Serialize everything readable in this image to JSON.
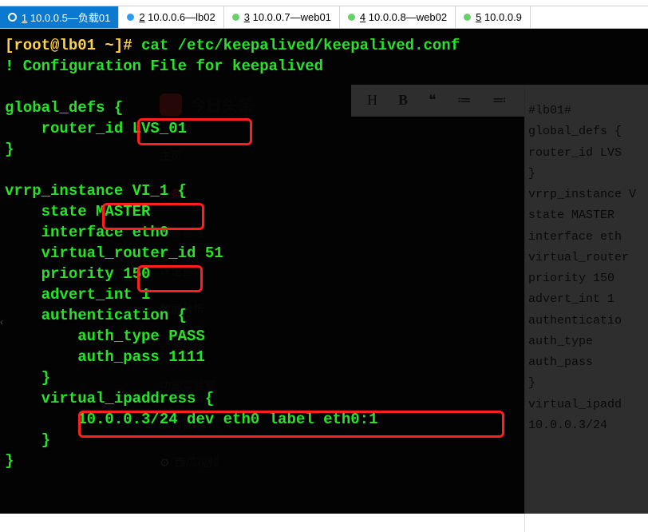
{
  "tabs": [
    {
      "num": "1",
      "label": "10.0.0.5—负载01",
      "active": true
    },
    {
      "num": "2",
      "label": "10.0.0.6—lb02"
    },
    {
      "num": "3",
      "label": "10.0.0.7—web01"
    },
    {
      "num": "4",
      "label": "10.0.0.8—web02"
    },
    {
      "num": "5",
      "label": "10.0.0.9"
    }
  ],
  "terminal": {
    "prompt_user": "[root@lb01 ~]# ",
    "command": "cat /etc/keepalived/keepalived.conf",
    "lines": [
      "! Configuration File for keepalived",
      "",
      "global_defs {",
      "    router_id LVS_01",
      "}",
      "",
      "vrrp_instance VI_1 {",
      "    state MASTER",
      "    interface eth0",
      "    virtual_router_id 51",
      "    priority 150",
      "    advert_int 1",
      "    authentication {",
      "        auth_type PASS",
      "        auth_pass 1111",
      "    }",
      "    virtual_ipaddress {",
      "        10.0.0.3/24 dev eth0 label eth0:1",
      "    }",
      "}"
    ]
  },
  "highlights": {
    "router_id": "LVS_01",
    "state": "MASTER",
    "priority": "150",
    "vip": "10.0.0.3/24 dev eth0 label eth0:1"
  },
  "ghost_nav": {
    "logo": "今日头条",
    "items": [
      "主页",
      "头条",
      "内容管理",
      "评论管理",
      "数据分析",
      "粉丝分析",
      "功能实验室",
      "素材管理",
      "西瓜视频"
    ]
  },
  "ghost_toolbar": [
    "H",
    "B",
    "❝",
    "≔",
    "≕",
    "—",
    "< >",
    "↗"
  ],
  "ghost_right": [
    "#lb01#",
    "global_defs {",
    "  router_id LVS",
    "}",
    "",
    "vrrp_instance V",
    "  state MASTER",
    "  interface eth",
    "  virtual_router",
    "  priority 150",
    "  advert_int 1",
    "  authenticatio",
    "    auth_type",
    "    auth_pass",
    "  }",
    "  virtual_ipadd",
    "    10.0.0.3/24"
  ]
}
